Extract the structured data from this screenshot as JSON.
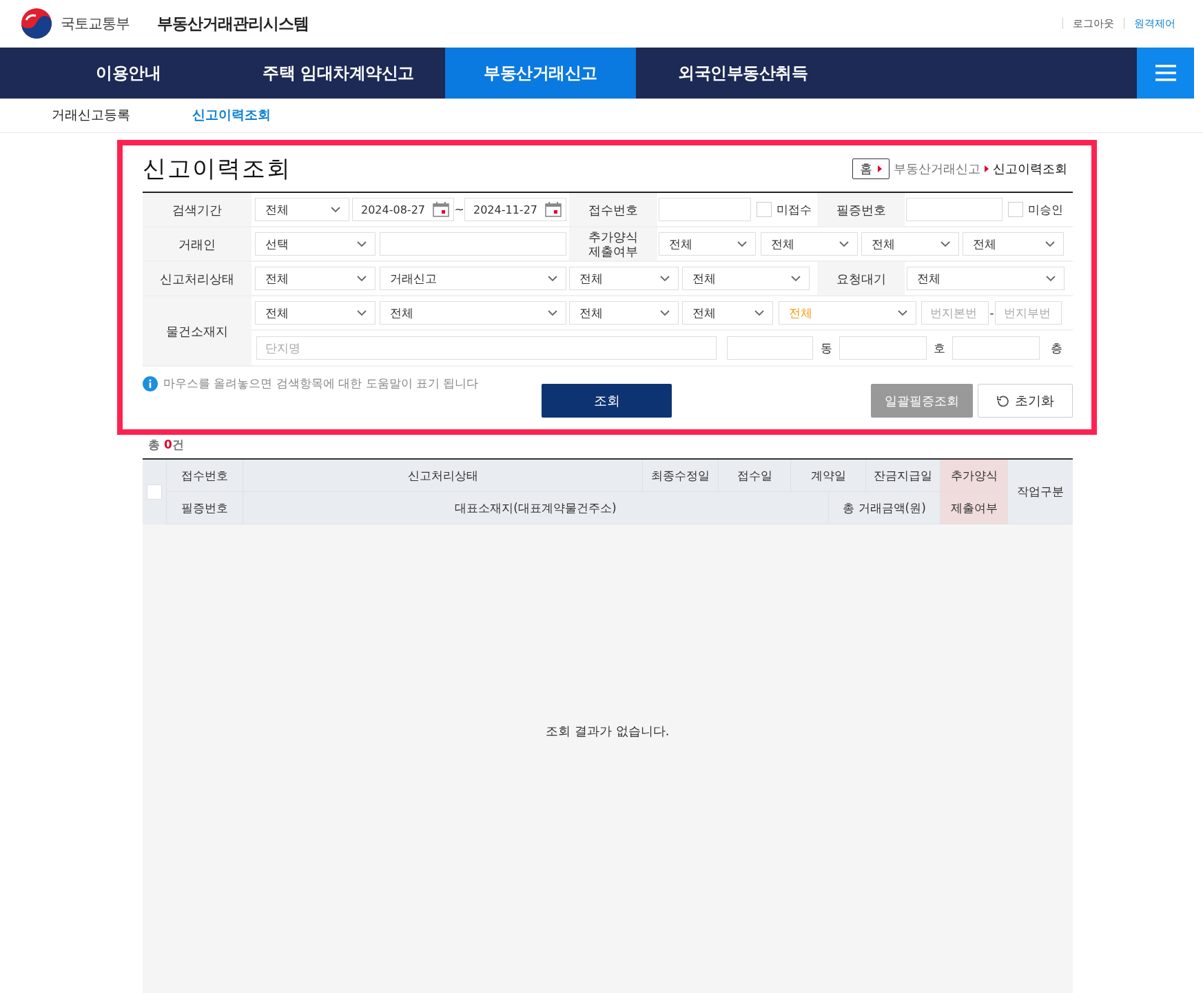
{
  "header": {
    "ministry": "국토교통부",
    "system_title": "부동산거래관리시스템",
    "links": [
      "로그아웃",
      "원격제어"
    ]
  },
  "nav": {
    "tabs": [
      {
        "label": "이용안내",
        "selected": false
      },
      {
        "label": "주택 임대차계약신고",
        "selected": false
      },
      {
        "label": "부동산거래신고",
        "selected": true
      },
      {
        "label": "외국인부동산취득",
        "selected": false
      }
    ]
  },
  "subnav": {
    "items": [
      {
        "label": "거래신고등록",
        "selected": false
      },
      {
        "label": "신고이력조회",
        "selected": true
      }
    ]
  },
  "page": {
    "title": "신고이력조회",
    "breadcrumb": [
      "홈",
      "부동산거래신고",
      "신고이력조회"
    ]
  },
  "search_form": {
    "search_period": {
      "label": "검색기간",
      "period": "전체",
      "start_date": "2024-08-27",
      "separator": "~",
      "end_date": "2024-11-27"
    },
    "receipt_no": {
      "label": "접수번호",
      "checkbox": {
        "label": "미접수",
        "checked": false
      }
    },
    "certificate_no": {
      "label": "필증번호",
      "checkbox": {
        "label": "미승인",
        "checked": false
      }
    },
    "party": {
      "label": "거래인",
      "type": "선택"
    },
    "additional_form": {
      "label_lines": [
        "추가양식",
        "제출여부"
      ],
      "selects": [
        "전체",
        "전체",
        "전체",
        "전체"
      ]
    },
    "status": {
      "label": "신고처리상태",
      "selects": [
        "전체",
        "거래신고",
        "전체",
        "전체"
      ]
    },
    "pending": {
      "label": "요청대기",
      "select": "전체"
    },
    "location": {
      "label": "물건소재지",
      "selects": [
        {
          "value": "전체",
          "highlighted": false
        },
        {
          "value": "전체",
          "highlighted": false
        },
        {
          "value": "전체",
          "highlighted": false
        },
        {
          "value": "전체",
          "highlighted": false
        },
        {
          "value": "전체",
          "highlighted": true
        }
      ],
      "lot_main_placeholder": "번지본번",
      "dash": "-",
      "lot_sub_placeholder": "번지부번",
      "complex_placeholder": "단지명",
      "units": [
        "동",
        "호",
        "층"
      ]
    },
    "help_text": "마우스를 올려놓으면 검색항목에 대한 도움말이 표기 됩니다",
    "buttons": {
      "search": "조회",
      "bulk": "일괄필증조회",
      "reset": "초기화"
    }
  },
  "results": {
    "total": "총 **0**건",
    "select_all_checked": false,
    "columns_row1": [
      {
        "label": "접수번호",
        "highlighted": false
      },
      {
        "label": "신고처리상태",
        "highlighted": false
      },
      {
        "label": "최종수정일",
        "highlighted": false
      },
      {
        "label": "접수일",
        "highlighted": false
      },
      {
        "label": "계약일",
        "highlighted": false
      },
      {
        "label": "잔금지급일",
        "highlighted": false
      },
      {
        "label": "추가양식",
        "highlighted": true
      }
    ],
    "columns_row2": [
      {
        "label": "필증번호",
        "highlighted": false
      },
      {
        "label": "대표소재지(대표계약물건주소)",
        "highlighted": false
      },
      {
        "label": "총 거래금액(원)",
        "highlighted": false
      },
      {
        "label": "제출여부",
        "highlighted": true
      }
    ],
    "work_type": "작업구분",
    "empty_message": "조회 결과가 없습니다."
  }
}
